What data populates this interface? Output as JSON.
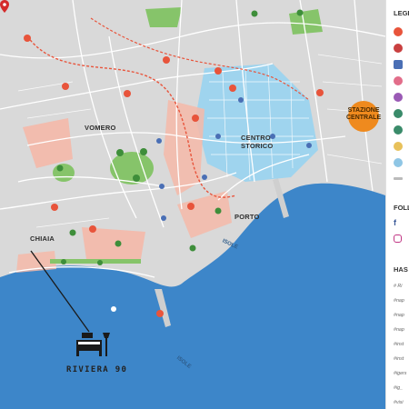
{
  "map": {
    "districts": {
      "vomero": "VOMERO",
      "centro_storico": "CENTRO\nSTORICO",
      "chiaia": "CHIAIA",
      "porto": "PORTO",
      "stazione": "STAZIONE\nCENTRALE"
    },
    "isole_labels": [
      "ISOLE",
      "ISOLE"
    ],
    "hotel_label": "RIVIERA 90",
    "colors": {
      "sea": "#3d86c9",
      "land": "#d9d9d9",
      "centro": "#9fd4ee",
      "pink": "#f4b8a8",
      "red_route": "#e8543b",
      "park": "#86c46a",
      "stazione": "#ef8a1e",
      "marker": "#d42b2b"
    },
    "icons": [
      "metro-icon",
      "funicular-icon",
      "hotel-pin-icon",
      "park-tree-icon",
      "bed-icon"
    ]
  },
  "legend": {
    "heading": "LEGE",
    "icon_colors": [
      "#e8543b",
      "#c94040",
      "#4a6fb5",
      "#e26d8a",
      "#9a5ab5",
      "#3a8b6a",
      "#e8c15a",
      "#8fc6e5",
      "#bbbbbb"
    ],
    "follow_heading": "FOLL",
    "social_icons": [
      "facebook-icon",
      "instagram-icon"
    ],
    "hashtags_heading": "HAS",
    "hashtags": [
      "# Ri",
      "#nap",
      "#nap",
      "#nap",
      "#inst",
      "#inst",
      "#igers",
      "#ig_",
      "#visi"
    ]
  }
}
